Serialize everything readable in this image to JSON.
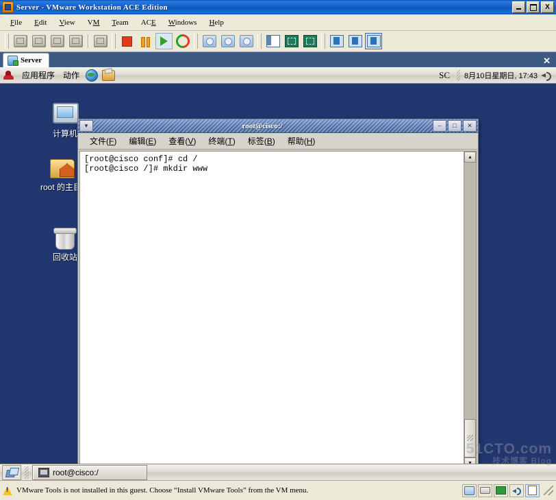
{
  "window": {
    "title": "Server - VMware Workstation ACE Edition",
    "app_icon": "vmware-icon",
    "controls": {
      "minimize": "minimize-icon",
      "maximize": "maximize-icon",
      "close": "X"
    }
  },
  "menubar": {
    "items": [
      {
        "label": "File",
        "accel": "F"
      },
      {
        "label": "Edit",
        "accel": "E"
      },
      {
        "label": "View",
        "accel": "V"
      },
      {
        "label": "VM",
        "accel": "M"
      },
      {
        "label": "Team",
        "accel": "T"
      },
      {
        "label": "ACE",
        "accel": "E"
      },
      {
        "label": "Windows",
        "accel": "W"
      },
      {
        "label": "Help",
        "accel": "H"
      }
    ]
  },
  "toolbar": {
    "buttons": [
      {
        "name": "new-virtual-machine-icon"
      },
      {
        "name": "new-team-icon"
      },
      {
        "name": "power-on-this-vm-icon"
      },
      {
        "name": "connect-device-icon"
      },
      {
        "name": "snapshot-manager-small-icon"
      },
      {
        "name": "power-off-icon"
      },
      {
        "name": "suspend-icon"
      },
      {
        "name": "power-on-icon"
      },
      {
        "name": "reset-icon"
      },
      {
        "name": "take-snapshot-icon"
      },
      {
        "name": "revert-snapshot-icon"
      },
      {
        "name": "manage-snapshots-icon"
      },
      {
        "name": "show-sidebar-icon"
      },
      {
        "name": "fullscreen-icon"
      },
      {
        "name": "quick-switch-icon"
      },
      {
        "name": "edit-vm-settings-icon"
      },
      {
        "name": "summary-view-icon"
      },
      {
        "name": "console-view-icon"
      }
    ]
  },
  "tabstrip": {
    "tabs": [
      {
        "label": "Server",
        "icon": "virtual-machine-icon",
        "active": true
      }
    ],
    "close_label": "✕"
  },
  "guest": {
    "panel": {
      "menu_icon": "red-hat-icon",
      "applications_label": "应用程序",
      "actions_label": "动作",
      "launchers": [
        {
          "name": "web-browser-icon"
        },
        {
          "name": "email-icon"
        }
      ],
      "input_method": "SC",
      "clock": "8月10日星期日, 17:43",
      "volume_icon": "volume-icon"
    },
    "desktop_icons": [
      {
        "name": "computer-icon",
        "label": "计算机"
      },
      {
        "name": "home-folder-icon",
        "label": "root 的主目录"
      },
      {
        "name": "trash-icon",
        "label": "回收站"
      }
    ],
    "terminal": {
      "title": "root@cisco:/",
      "window_menu_icon": "window-menu-icon",
      "controls": {
        "minimize": "–",
        "maximize": "□",
        "close": "✕"
      },
      "menus": [
        {
          "label": "文件(F)",
          "accel": "F"
        },
        {
          "label": "编辑(E)",
          "accel": "E"
        },
        {
          "label": "查看(V)",
          "accel": "V"
        },
        {
          "label": "终端(T)",
          "accel": "T"
        },
        {
          "label": "标签(B)",
          "accel": "B"
        },
        {
          "label": "帮助(H)",
          "accel": "H"
        }
      ],
      "content": "[root@cisco conf]# cd /\n[root@cisco /]# mkdir www",
      "scrollbar": {
        "up": "▲",
        "down": "▼"
      }
    },
    "taskbar": {
      "show_desktop_icon": "show-desktop-icon",
      "windows": [
        {
          "label": "root@cisco:/",
          "icon": "terminal-icon"
        }
      ]
    }
  },
  "statusbar": {
    "warning_icon": "warning-icon",
    "message": "VMware Tools is not installed in this guest. Choose “Install VMware Tools” from the VM menu.",
    "devices": [
      {
        "name": "hard-disk-icon",
        "active": false
      },
      {
        "name": "cd-rom-icon",
        "active": false
      },
      {
        "name": "network-adapter-icon",
        "active": false
      },
      {
        "name": "sound-adapter-icon",
        "active": false
      },
      {
        "name": "printer-icon",
        "active": true
      }
    ]
  },
  "watermark": {
    "line1": "51CTO.com",
    "line2": "技术博客 Blog"
  },
  "colors": {
    "title_blue": "#1660c8",
    "desktop_blue": "#22366f",
    "tabstrip_blue": "#3c5a82",
    "chrome_grey": "#ece9d8",
    "terminal_title": "#4d6fab"
  }
}
